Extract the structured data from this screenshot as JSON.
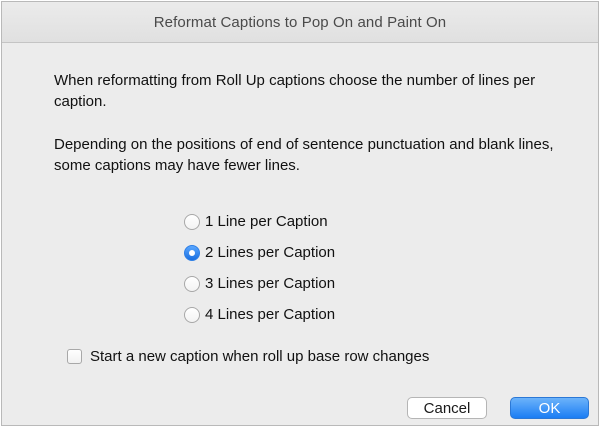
{
  "window": {
    "title": "Reformat Captions to Pop On and Paint On"
  },
  "message": {
    "paragraph1": "When reformatting from Roll Up captions choose the number of lines per caption.",
    "paragraph2": "Depending on the positions of end of sentence punctuation and blank lines, some captions may have fewer lines."
  },
  "options": {
    "selected_index": 1,
    "items": [
      {
        "label": "1 Line per Caption",
        "checked": false
      },
      {
        "label": "2 Lines per Caption",
        "checked": true
      },
      {
        "label": "3 Lines per Caption",
        "checked": false
      },
      {
        "label": "4 Lines per Caption",
        "checked": false
      }
    ]
  },
  "checkbox": {
    "label": "Start a new caption when roll up base row changes",
    "checked": false
  },
  "buttons": {
    "cancel_label": "Cancel",
    "ok_label": "OK"
  },
  "colors": {
    "accent": "#1b7df4",
    "dialog_background": "#ececec"
  },
  "icons": {
    "radio_checked": "radio-checked-icon",
    "radio_unchecked": "radio-unchecked-icon",
    "checkbox_unchecked": "checkbox-unchecked-icon"
  }
}
